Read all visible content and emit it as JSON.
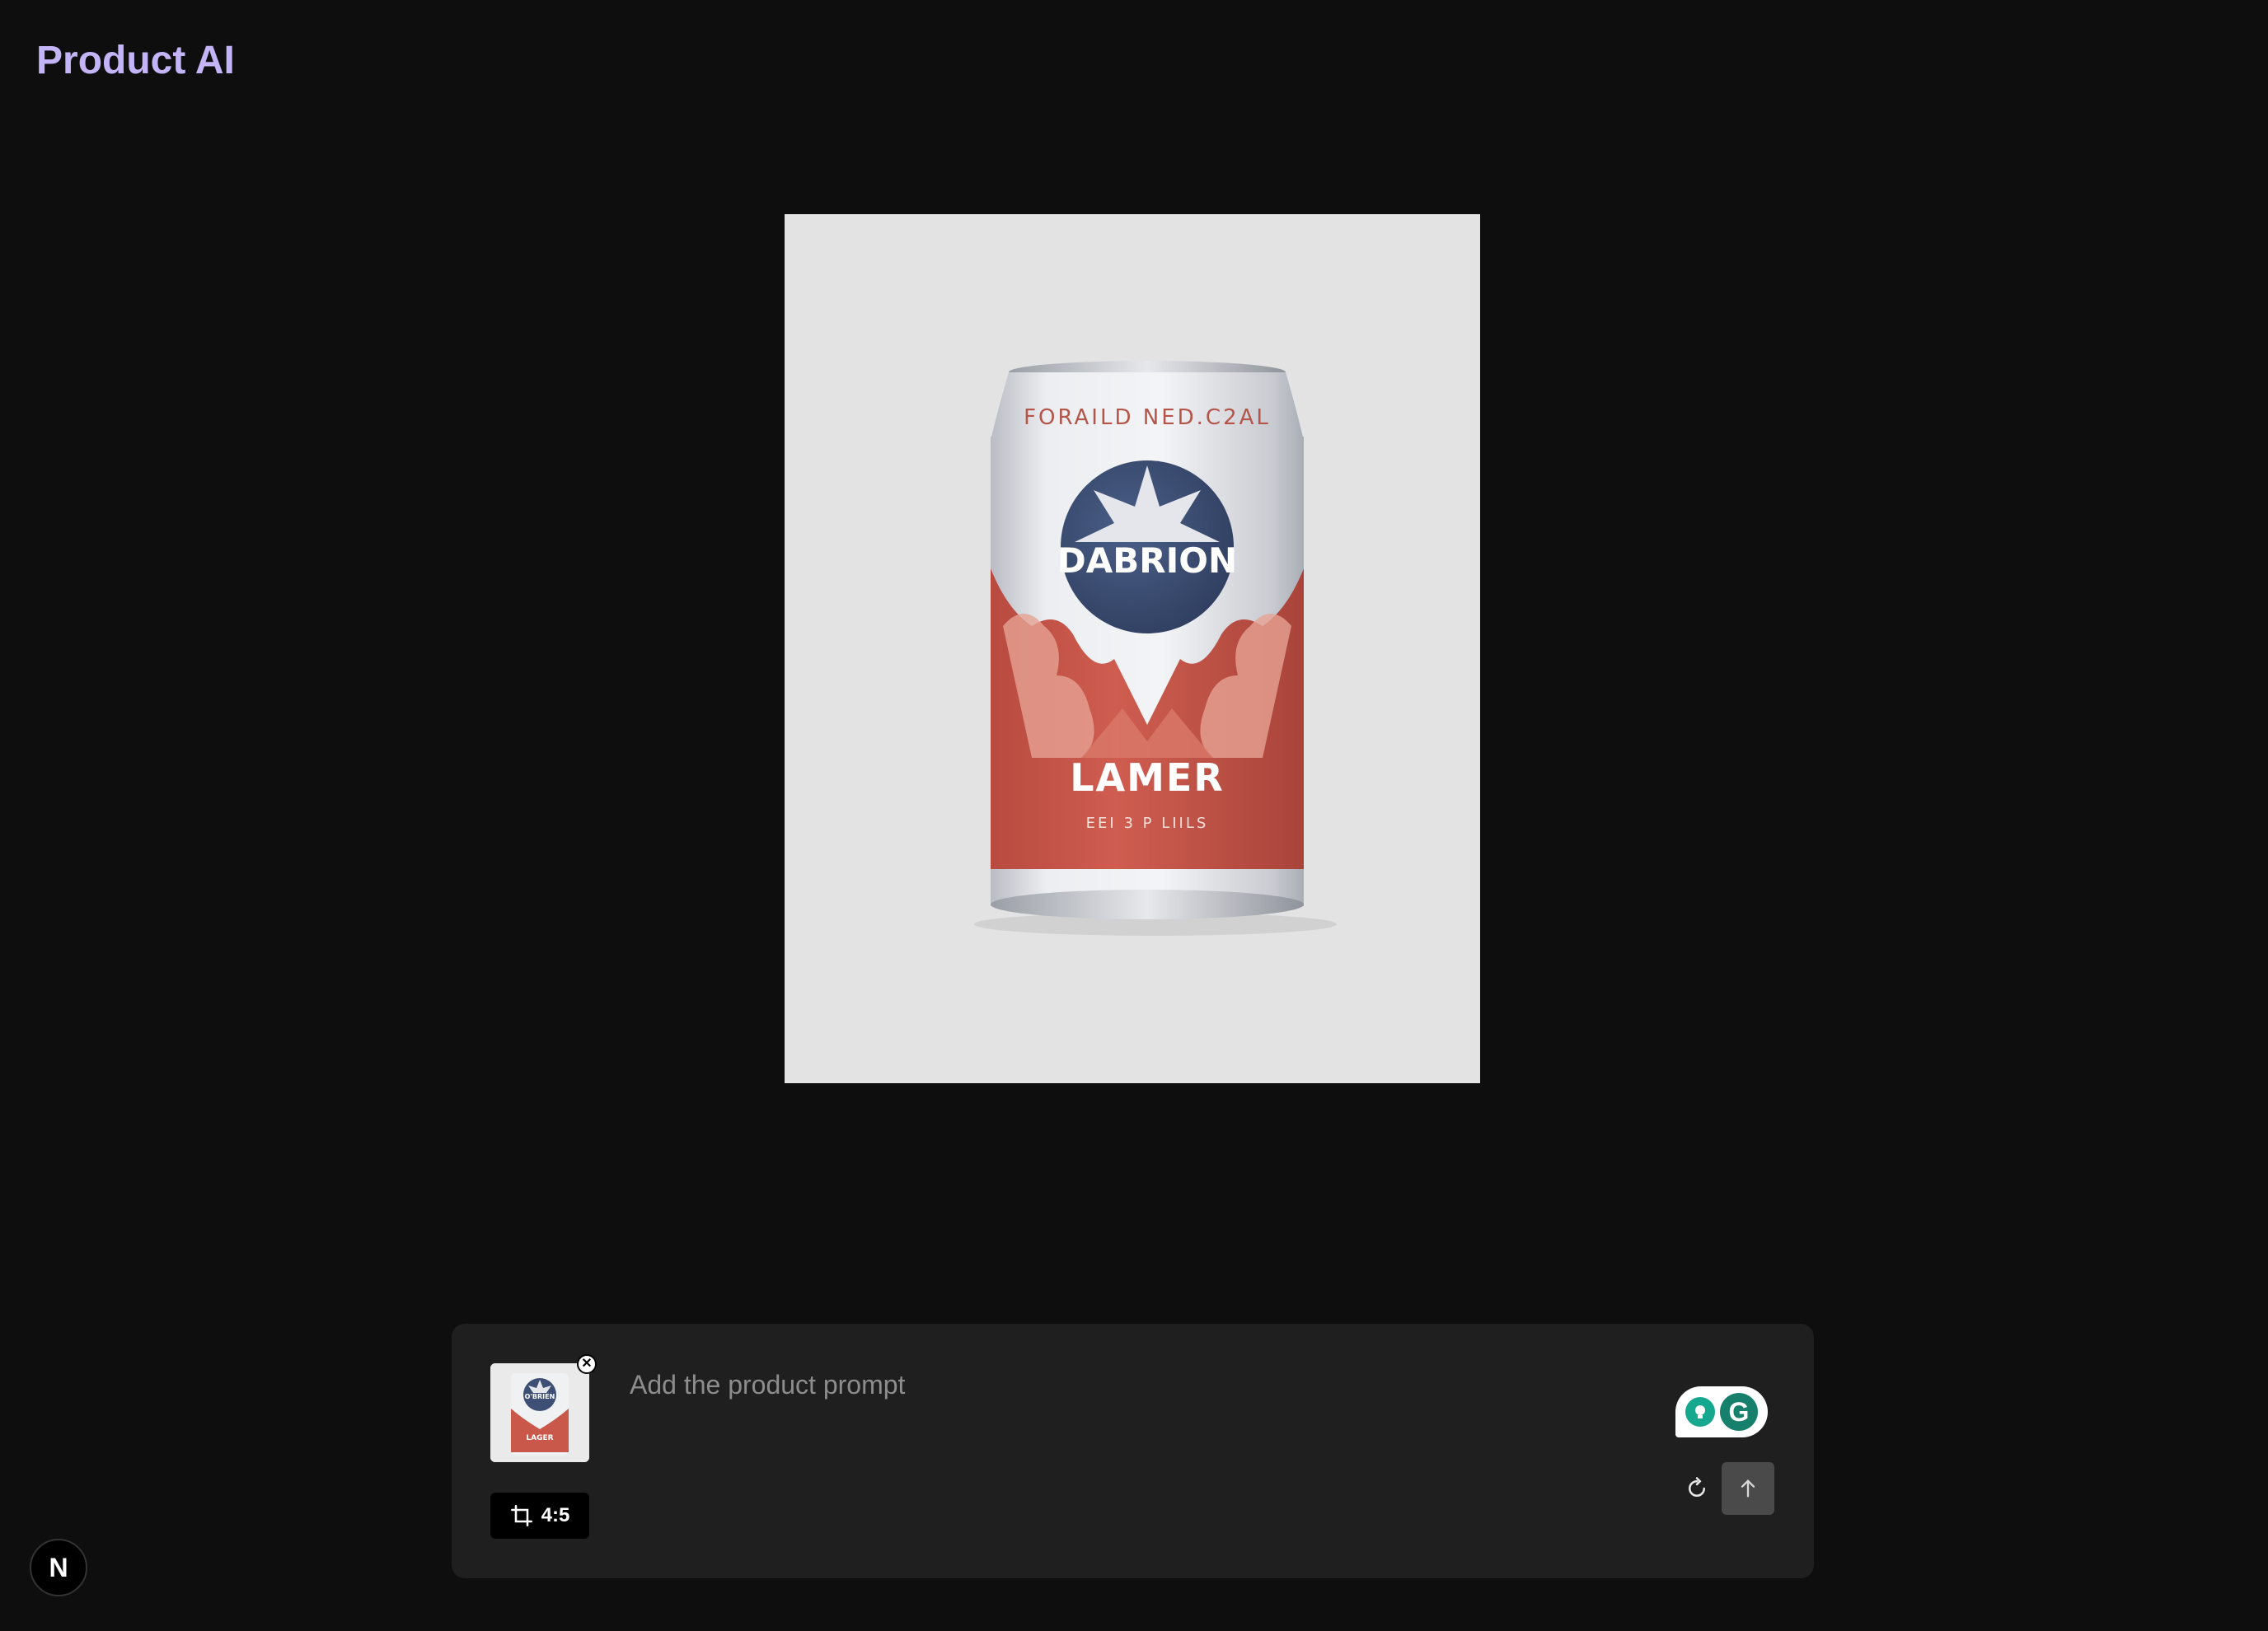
{
  "app": {
    "title": "Product AI"
  },
  "preview": {
    "can_label": {
      "top_text": "FORAILD NED.C2AL",
      "brand": "DABRION",
      "product": "LAMER",
      "subtext": "EEI 3 P LIILS"
    }
  },
  "composer": {
    "prompt_placeholder": "Add the product prompt",
    "prompt_value": "",
    "aspect_ratio_label": "4:5",
    "thumbnail_can": {
      "brand": "O'BRIEN",
      "product": "LAGER"
    }
  },
  "dev_badge": {
    "label": "N"
  },
  "colors": {
    "accent_title": "#c3b3f7",
    "background": "#0e0e0e",
    "composer_bg": "#1f1f1f",
    "can_red": "#c9574a",
    "can_navy": "#3d4f74",
    "grammarly_green": "#16806d"
  },
  "icons": {
    "remove": "close-icon",
    "aspect": "crop-icon",
    "reset": "refresh-icon",
    "submit": "arrow-up-icon",
    "grammarly": "grammarly-icon"
  }
}
